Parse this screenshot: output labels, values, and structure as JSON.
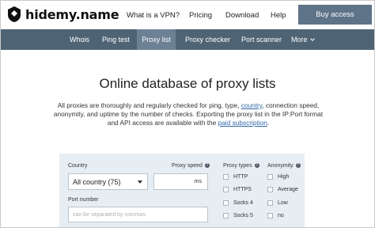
{
  "brand": {
    "name": "hidemy.name"
  },
  "topnav": {
    "items": [
      "What is a VPN?",
      "Pricing",
      "Download",
      "Help"
    ],
    "buy_label": "Buy access"
  },
  "subnav": {
    "items": [
      "Whois",
      "Ping test",
      "Proxy list",
      "Proxy checker",
      "Port scanner",
      "More"
    ],
    "active": "Proxy list"
  },
  "hero": {
    "title": "Online database of proxy lists",
    "text_1": "All proxies are thoroughly and regularly checked for ping, type, ",
    "link_country": "country",
    "text_2": ", connection speed, anonymity, and uptime by the number of checks. Exporting the proxy list in the IP:Port format and API access are available with the ",
    "link_subscription": "paid subscription",
    "text_3": "."
  },
  "filters": {
    "country_label": "Country",
    "country_value": "All country (75)",
    "speed_label": "Proxy speed",
    "speed_unit": "ms",
    "port_label": "Port number",
    "port_placeholder": "can be separated by commas",
    "types_label": "Proxy types",
    "types": [
      "HTTP",
      "HTTPS",
      "Socks 4",
      "Socks 5"
    ],
    "anonymity_label": "Anonymity",
    "anonymity": [
      "High",
      "Average",
      "Low",
      "no"
    ],
    "info_glyph": "?"
  },
  "colors": {
    "subnav_bg": "#4e6475",
    "subnav_active": "#6c8194",
    "buy_button": "#5d7388",
    "panel_bg": "#e6eef3",
    "link": "#2f6aa8"
  }
}
